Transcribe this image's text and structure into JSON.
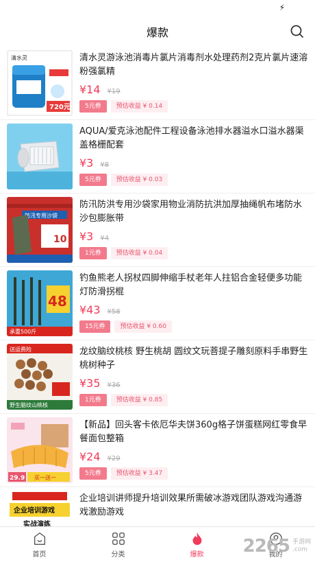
{
  "status": {
    "flash_icon": "flash-icon"
  },
  "header": {
    "title": "爆款",
    "search_icon": "search-icon"
  },
  "products": [
    {
      "name": "清水灵游泳池消毒片氯片消毒剂水处理药剂2克片氯片速溶粉强氯精",
      "price": "¥14",
      "orig": "¥19",
      "coupon": "5元券",
      "earn": "预估收益 ¥ 0.14",
      "thumb_text": "清水灵",
      "thumb_sub": "720元"
    },
    {
      "name": "AQUA/爱克泳池配件工程设备泳池排水器溢水口溢水器渠盖格栅配套",
      "price": "¥3",
      "orig": "¥8",
      "coupon": "5元券",
      "earn": "预估收益 ¥ 0.03",
      "thumb_text": "",
      "thumb_sub": ""
    },
    {
      "name": "防汛防洪专用沙袋家用物业消防抗洪加厚抽绳帆布堵防水沙包膨胀带",
      "price": "¥3",
      "orig": "¥4",
      "coupon": "1元券",
      "earn": "预估收益 ¥ 0.04",
      "thumb_text": "防汛专用沙袋",
      "thumb_sub": "10"
    },
    {
      "name": "钓鱼熊老人拐杖四脚伸缩手杖老年人拄铝合金轻便多功能灯防滑拐棍",
      "price": "¥43",
      "orig": "¥58",
      "coupon": "15元券",
      "earn": "预估收益 ¥ 0.60",
      "thumb_text": "48",
      "thumb_sub": "承重500斤"
    },
    {
      "name": "龙纹脑纹桃核 野生桃胡 圆纹文玩菩提子雕刻原料手串野生桃树种子",
      "price": "¥35",
      "orig": "¥36",
      "coupon": "1元券",
      "earn": "预估收益 ¥ 0.85",
      "thumb_text": "送运费险",
      "thumb_sub": "野生脑纹山桃核"
    },
    {
      "name": "【新品】回头客卡依厄华夫饼360g格子饼蛋糕网红零食早餐面包整箱",
      "price": "¥24",
      "orig": "¥29",
      "coupon": "5元券",
      "earn": "预估收益 ¥ 3.47",
      "thumb_text": "29.9",
      "thumb_sub": "买一送一"
    },
    {
      "name": "企业培训讲师提升培训效果所需破冰游戏团队游戏沟通游戏激励游戏",
      "price": "",
      "orig": "",
      "coupon": "",
      "earn": "",
      "thumb_text": "企业培训游戏",
      "thumb_sub": "实战演练"
    }
  ],
  "tabs": [
    {
      "label": "首页",
      "icon": "home-icon"
    },
    {
      "label": "分类",
      "icon": "grid-icon"
    },
    {
      "label": "爆款",
      "icon": "flame-icon"
    },
    {
      "label": "我的",
      "icon": "user-icon"
    }
  ],
  "watermark": {
    "big": "2265",
    "small1": "手游网",
    "small2": ".com"
  },
  "colors": {
    "accent": "#f03c5a",
    "coupon_bg": "#f27a8c",
    "earn_bg": "#fdeef1"
  }
}
